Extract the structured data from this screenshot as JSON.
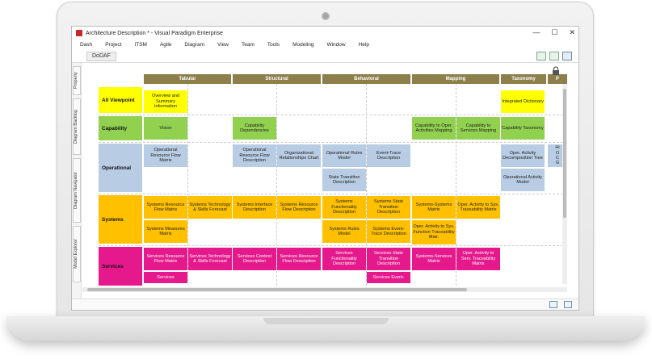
{
  "window": {
    "title": "Architecture Description * - Visual Paradigm Enterprise",
    "controls": [
      "—",
      "☐",
      "✕"
    ]
  },
  "menu": [
    "Dash",
    "Project",
    "ITSM",
    "Agile",
    "Diagram",
    "View",
    "Team",
    "Tools",
    "Modeling",
    "Window",
    "Help"
  ],
  "breadcrumb": "DoDAF",
  "side_tabs": [
    "Property",
    "Diagram Backlog",
    "Diagram Navigator",
    "Model Explorer"
  ],
  "columns": [
    "Tabular",
    "Structural",
    "Behavioral",
    "Mapping",
    "Taxonomy",
    "P"
  ],
  "rows": [
    "All Viewpoint",
    "Capability",
    "Operational",
    "Systems",
    "Services"
  ],
  "colors": {
    "header": "#8c7f4b",
    "all_viewpoint": "#ffff00",
    "capability": "#92d050",
    "operational": "#b8cce4",
    "systems": "#ffc000",
    "services": "#e6198c"
  },
  "cells": {
    "all_tabular": "Overview and Summary Information",
    "all_taxonomy": "Integrated Dictionary",
    "cap_tabular": "Vision",
    "cap_structural": "Capability Dependencies",
    "cap_map1": "Capability to Oper. Activities Mapping",
    "cap_map2": "Capability to Services Mapping",
    "cap_taxonomy": "Capability Taxonomy",
    "op_tab1": "Operational Resource Flow Matrix",
    "op_str1": "Operational Resource Flow Description",
    "op_str2": "Organizational Relationships Chart",
    "op_beh1": "Operational Rules Model",
    "op_beh2": "Event-Trace Description",
    "op_beh3": "State Transition Description",
    "op_tax1": "Oper. Activity Decomposition Tree",
    "op_tax2": "Operational Activity Model",
    "op_cut": "Hi",
    "op_cut2": "O",
    "op_cut3": "C",
    "op_cut4": "G",
    "sys_tab1": "Systems Resource Flow Matrix",
    "sys_tab2": "Systems Technology & Skills Forecast",
    "sys_tab3": "Systems Measures Matrix",
    "sys_str1": "Systems Interface Description",
    "sys_str2": "Systems Resource Flow Description",
    "sys_beh1": "Systems Functionality Description",
    "sys_beh2": "Systems State Transition Description",
    "sys_beh3": "Systems Rules Model",
    "sys_beh4": "Systems Event-Trace Description",
    "sys_map1": "Systems-Systems Matrix",
    "sys_map2": "Oper. Activity to Sys. Traceability Matrix",
    "sys_map3": "Oper. Activity to Sys. Function Traceability Matr.",
    "svc_tab1": "Services Resource Flow Matrix",
    "svc_tab2": "Services Technology & Skills Forecast",
    "svc_tab3": "Services",
    "svc_str1": "Services Context Description",
    "svc_str2": "Services Resource Flow Description",
    "svc_beh1": "Services Functionality Description",
    "svc_beh2": "Services State Transition Description",
    "svc_beh4": "Services Event-",
    "svc_map1": "Systems-Services Matrix",
    "svc_map2": "Oper. Activity to Serv. Traceability Matrix"
  }
}
